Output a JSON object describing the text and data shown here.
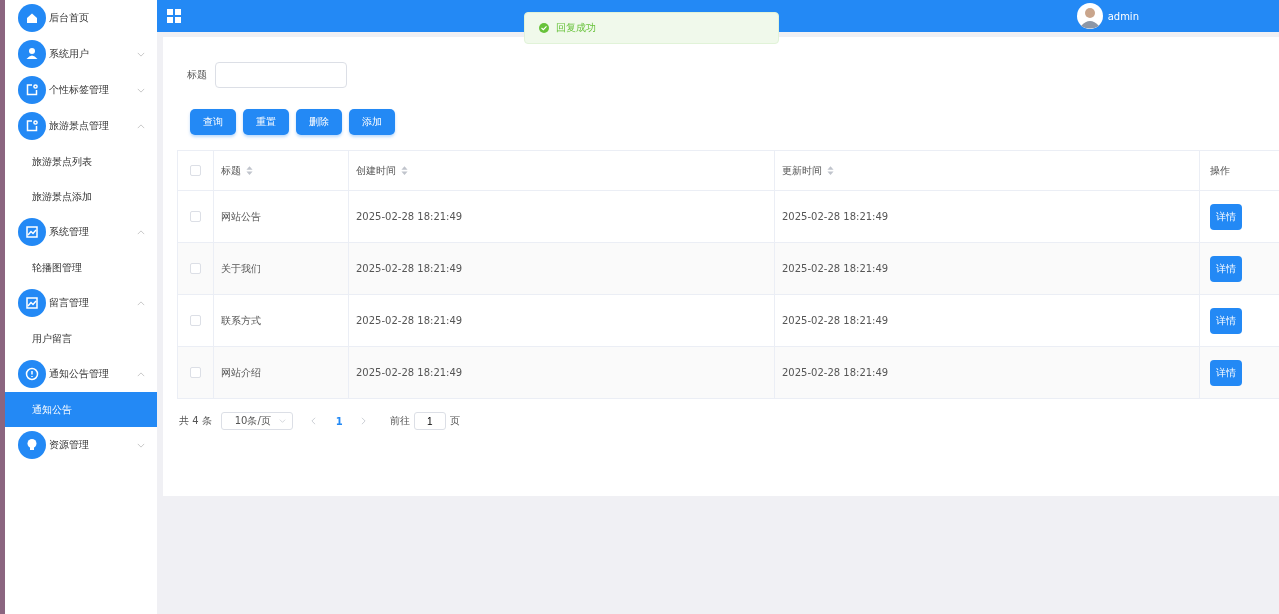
{
  "sidebar": {
    "items": [
      {
        "label": "后台首页"
      },
      {
        "label": "系统用户",
        "expanded": false
      },
      {
        "label": "个性标签管理",
        "expanded": false
      },
      {
        "label": "旅游景点管理",
        "expanded": true,
        "children": [
          {
            "label": "旅游景点列表",
            "selected": false
          },
          {
            "label": "旅游景点添加",
            "selected": false
          }
        ]
      },
      {
        "label": "系统管理",
        "expanded": true,
        "children": [
          {
            "label": "轮播图管理",
            "selected": false
          }
        ]
      },
      {
        "label": "留言管理",
        "expanded": true,
        "children": [
          {
            "label": "用户留言",
            "selected": false
          }
        ]
      },
      {
        "label": "通知公告管理",
        "expanded": true,
        "children": [
          {
            "label": "通知公告",
            "selected": true
          }
        ]
      },
      {
        "label": "资源管理",
        "expanded": false
      }
    ]
  },
  "header": {
    "user": "admin"
  },
  "toast": {
    "text": "回复成功"
  },
  "filter": {
    "label": "标题"
  },
  "buttons": [
    "查询",
    "重置",
    "删除",
    "添加"
  ],
  "table": {
    "columns": [
      {
        "label": "标题",
        "kind": "sortable"
      },
      {
        "label": "创建时间",
        "kind": "sortable"
      },
      {
        "label": "更新时间",
        "kind": "sortable"
      },
      {
        "label": "操作",
        "kind": "plain"
      }
    ],
    "all_checked": false,
    "rows": [
      {
        "checked": false,
        "title": "网站公告",
        "created": "2025-02-28 18:21:49",
        "updated": "2025-02-28 18:21:49",
        "action": "详情"
      },
      {
        "checked": false,
        "title": "关于我们",
        "created": "2025-02-28 18:21:49",
        "updated": "2025-02-28 18:21:49",
        "action": "详情"
      },
      {
        "checked": false,
        "title": "联系方式",
        "created": "2025-02-28 18:21:49",
        "updated": "2025-02-28 18:21:49",
        "action": "详情"
      },
      {
        "checked": false,
        "title": "网站介绍",
        "created": "2025-02-28 18:21:49",
        "updated": "2025-02-28 18:21:49",
        "action": "详情"
      }
    ]
  },
  "pagination": {
    "total": "共 4 条",
    "page_size": "10条/页",
    "pages": [
      {
        "label": "1",
        "selected": true
      }
    ],
    "goto_label": "前往",
    "goto_value": "1",
    "goto_suffix": "页"
  }
}
